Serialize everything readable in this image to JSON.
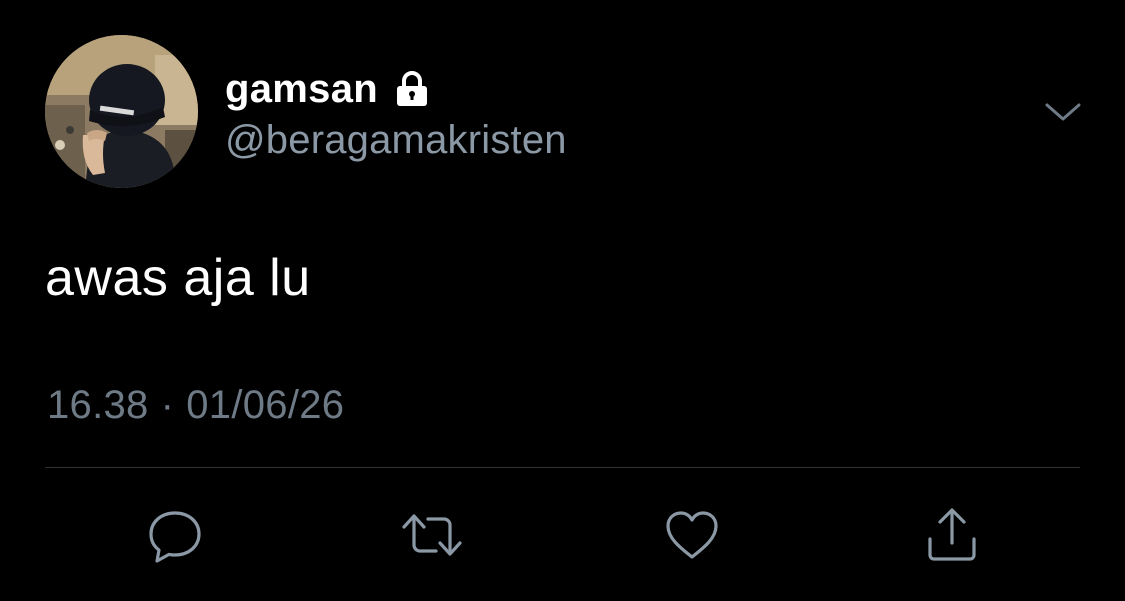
{
  "author": {
    "display_name": "gamsan",
    "username": "@beragamakristen",
    "protected": true,
    "avatar": "avatar-photo"
  },
  "tweet": {
    "text": "awas aja lu",
    "time": "16.38",
    "separator": "·",
    "date": "01/06/26"
  },
  "actions": [
    {
      "name": "reply",
      "icon": "reply-icon"
    },
    {
      "name": "retweet",
      "icon": "retweet-icon"
    },
    {
      "name": "like",
      "icon": "heart-icon"
    },
    {
      "name": "share",
      "icon": "share-icon"
    }
  ],
  "colors": {
    "background": "#000000",
    "primary_text": "#ffffff",
    "secondary_text": "#8b98a5",
    "meta_text": "#6e7a86",
    "divider": "#2f3336",
    "icon": "#8b98a5"
  }
}
